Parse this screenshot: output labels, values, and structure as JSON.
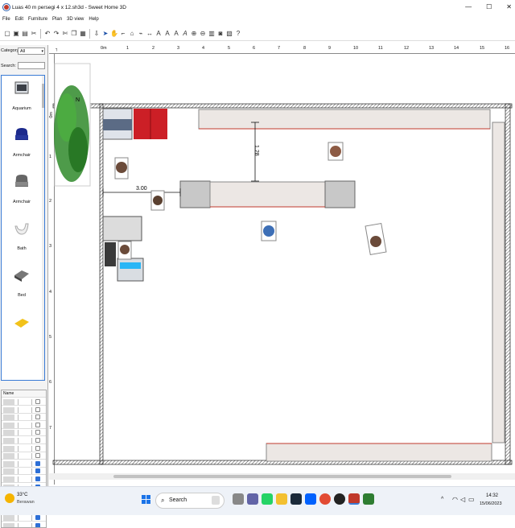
{
  "window": {
    "title": "Luas 40 m persegi 4 x 12.sh3d - Sweet Home 3D",
    "controls": [
      "—",
      "☐",
      "✕"
    ]
  },
  "menu": [
    "File",
    "Edit",
    "Furniture",
    "Plan",
    "3D view",
    "Help"
  ],
  "left": {
    "category_label": "Category:",
    "category_value": "All",
    "search_label": "Search:",
    "search_value": "",
    "catalog": [
      "Aquarium",
      "Armchair",
      "Armchair",
      "Bath",
      "Bed"
    ],
    "list_header": "Name"
  },
  "plan": {
    "ruler_h": [
      "0m",
      "1",
      "2",
      "3",
      "4",
      "5",
      "6",
      "7",
      "8",
      "9",
      "10",
      "11",
      "12",
      "13",
      "14",
      "15",
      "16"
    ],
    "ruler_v": [
      "0m",
      "1",
      "2",
      "3",
      "4",
      "5",
      "6",
      "7"
    ],
    "dim_horizontal": "3.00",
    "dim_vertical": "1.28",
    "compass": "N"
  },
  "taskbar": {
    "weather_temp": "33°C",
    "weather_desc": "Berawan",
    "search_placeholder": "Search",
    "time": "14:32",
    "date": "15/06/2023"
  }
}
